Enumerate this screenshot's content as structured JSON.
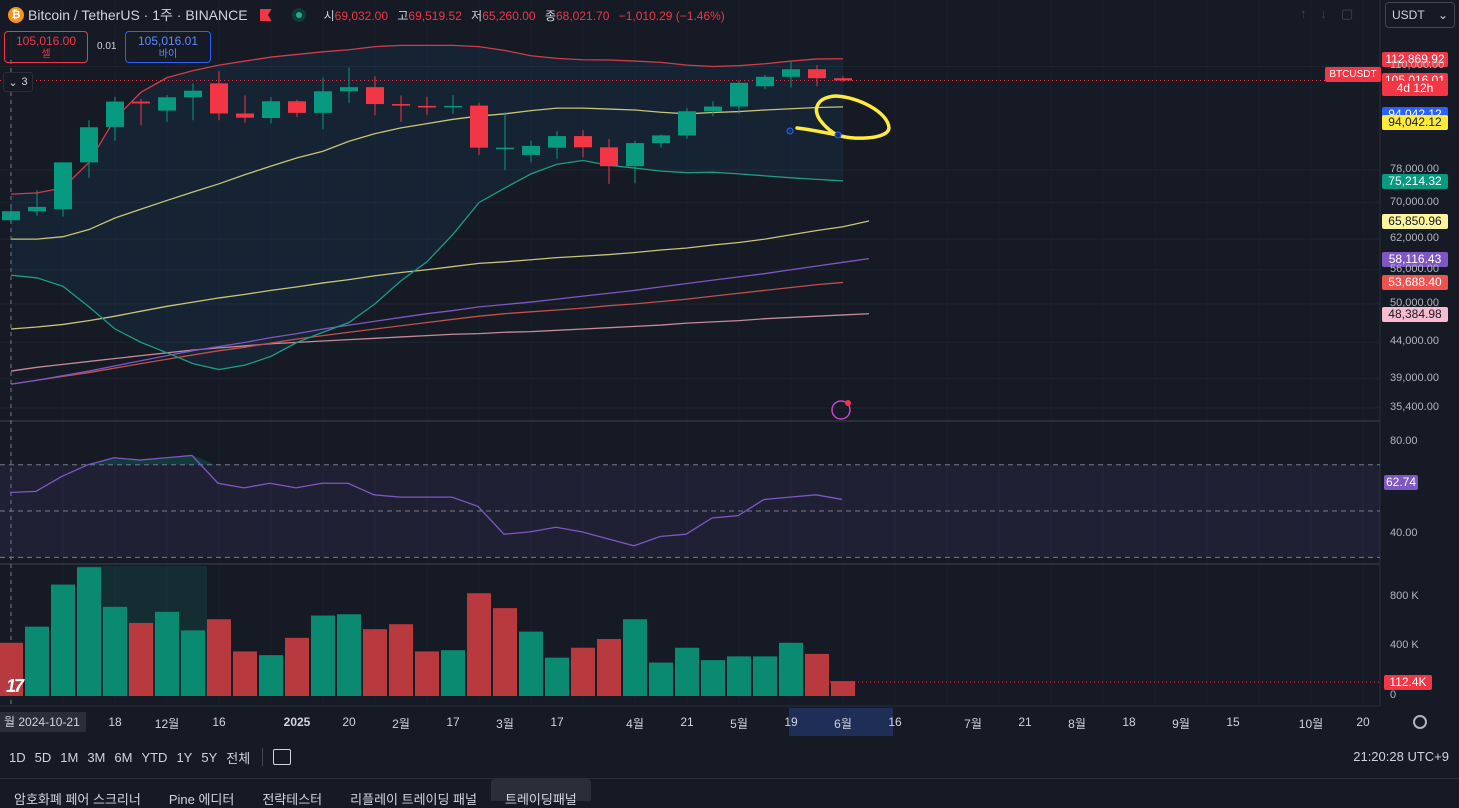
{
  "header": {
    "title": "Bitcoin / TetherUS · 1주 · BINANCE",
    "coin_glyph": "₿",
    "ohlc": [
      {
        "k": "시",
        "v": "69,032.00"
      },
      {
        "k": "고",
        "v": "69,519.52"
      },
      {
        "k": "저",
        "v": "65,260.00"
      },
      {
        "k": "종",
        "v": "68,021.70"
      }
    ],
    "change": "−1,010.29 (−1.46%)"
  },
  "trade": {
    "sell_price": "105,016.00",
    "sell_label": "셀",
    "spread": "0.01",
    "buy_price": "105,016.01",
    "buy_label": "바이"
  },
  "indicator_collapse": "3",
  "currency_select": "USDT",
  "symbol_tag": "BTCUSDT",
  "price_labels": [
    {
      "text": "112,869.92",
      "bg": "#f23645",
      "fg": "#ffffff",
      "price": 112869.92
    },
    {
      "text": "105,016.01",
      "bg": "#f23645",
      "fg": "#ffffff",
      "price": 105016.01
    },
    {
      "text": "4d 12h",
      "bg": "#f23645",
      "fg": "#ffffff",
      "price": 102400
    },
    {
      "text": "94,042.12",
      "bg": "#2962ff",
      "fg": "#ffffff",
      "price": 94042.12
    },
    {
      "text": "94,042.12",
      "bg": "#ffeb3b",
      "fg": "#131722",
      "price": 91500
    },
    {
      "text": "75,214.32",
      "bg": "#089981",
      "fg": "#ffffff",
      "price": 75214.32
    },
    {
      "text": "65,850.96",
      "bg": "#fff59d",
      "fg": "#131722",
      "price": 65850.96
    },
    {
      "text": "58,116.43",
      "bg": "#7e57c2",
      "fg": "#ffffff",
      "price": 58116.43
    },
    {
      "text": "53,688.40",
      "bg": "#ef5350",
      "fg": "#ffffff",
      "price": 53688.4
    },
    {
      "text": "48,384.98",
      "bg": "#f8bbd0",
      "fg": "#131722",
      "price": 48384.98
    }
  ],
  "price_ticks": [
    {
      "text": "110,000.00",
      "price": 110000
    },
    {
      "text": "78,000.00",
      "price": 78000
    },
    {
      "text": "70,000.00",
      "price": 70000
    },
    {
      "text": "62,000.00",
      "price": 62000
    },
    {
      "text": "56,000.00",
      "price": 56000
    },
    {
      "text": "50,000.00",
      "price": 50000
    },
    {
      "text": "44,000.00",
      "price": 44000
    },
    {
      "text": "39,000.00",
      "price": 39000
    },
    {
      "text": "35,400.00",
      "price": 35400
    }
  ],
  "rsi": {
    "ticks": [
      "80.00",
      "60.00",
      "40.00"
    ],
    "ticks_values": [
      80,
      60,
      40
    ],
    "current": "62.74",
    "current_value": 62.74,
    "values": [
      58,
      58.5,
      65,
      70,
      73,
      72,
      73,
      74,
      62,
      60,
      62,
      60,
      62,
      62,
      57,
      56,
      56,
      56,
      52,
      40,
      41,
      43,
      41,
      38,
      35,
      39,
      40,
      47,
      48,
      55,
      56,
      57,
      55,
      54
    ]
  },
  "volume": {
    "ticks": [
      "800 K",
      "400 K",
      "0"
    ],
    "ticks_values": [
      800,
      400,
      0
    ],
    "current": "112.4K",
    "current_value": 112.4,
    "values": [
      430,
      560,
      900,
      1040,
      720,
      590,
      680,
      530,
      620,
      360,
      330,
      470,
      650,
      660,
      540,
      580,
      360,
      370,
      830,
      710,
      520,
      310,
      390,
      460,
      620,
      270,
      390,
      290,
      320,
      320,
      430,
      340,
      120
    ],
    "up": [
      false,
      true,
      true,
      true,
      true,
      false,
      true,
      true,
      false,
      false,
      true,
      false,
      true,
      true,
      false,
      false,
      false,
      true,
      false,
      false,
      true,
      true,
      false,
      false,
      true,
      true,
      true,
      true,
      true,
      true,
      true,
      false,
      false
    ]
  },
  "chart_data": {
    "type": "candlestick",
    "scale": "log",
    "ylim": [
      34000,
      125000
    ],
    "candles": [
      {
        "o": 66000,
        "h": 69500,
        "l": 65260,
        "c": 68021
      },
      {
        "o": 68000,
        "h": 73000,
        "l": 67000,
        "c": 69000
      },
      {
        "o": 68500,
        "h": 80000,
        "l": 66800,
        "c": 80000
      },
      {
        "o": 80000,
        "h": 92000,
        "l": 76000,
        "c": 89900
      },
      {
        "o": 90000,
        "h": 99500,
        "l": 86000,
        "c": 97900
      },
      {
        "o": 97900,
        "h": 98800,
        "l": 90500,
        "c": 97300
      },
      {
        "o": 95000,
        "h": 100000,
        "l": 91500,
        "c": 99300
      },
      {
        "o": 99300,
        "h": 104000,
        "l": 92000,
        "c": 101500
      },
      {
        "o": 104000,
        "h": 108300,
        "l": 92000,
        "c": 94100
      },
      {
        "o": 94100,
        "h": 99900,
        "l": 91300,
        "c": 92800
      },
      {
        "o": 92700,
        "h": 99300,
        "l": 91000,
        "c": 98000
      },
      {
        "o": 98000,
        "h": 98500,
        "l": 93000,
        "c": 94300
      },
      {
        "o": 94300,
        "h": 106000,
        "l": 89300,
        "c": 101300
      },
      {
        "o": 101300,
        "h": 109600,
        "l": 97500,
        "c": 102700
      },
      {
        "o": 102700,
        "h": 106500,
        "l": 93500,
        "c": 97100
      },
      {
        "o": 97100,
        "h": 99900,
        "l": 91500,
        "c": 96600
      },
      {
        "o": 96500,
        "h": 99500,
        "l": 93700,
        "c": 96000
      },
      {
        "o": 96200,
        "h": 100000,
        "l": 94000,
        "c": 96500
      },
      {
        "o": 96600,
        "h": 97500,
        "l": 82000,
        "c": 84000
      },
      {
        "o": 84000,
        "h": 94500,
        "l": 78000,
        "c": 84000
      },
      {
        "o": 82000,
        "h": 86000,
        "l": 80000,
        "c": 84500
      },
      {
        "o": 84000,
        "h": 88700,
        "l": 81000,
        "c": 87300
      },
      {
        "o": 87300,
        "h": 89000,
        "l": 81300,
        "c": 84100
      },
      {
        "o": 84100,
        "h": 86500,
        "l": 74500,
        "c": 79000
      },
      {
        "o": 79000,
        "h": 86000,
        "l": 74600,
        "c": 85300
      },
      {
        "o": 85300,
        "h": 87800,
        "l": 84000,
        "c": 87500
      },
      {
        "o": 87500,
        "h": 95800,
        "l": 86500,
        "c": 94800
      },
      {
        "o": 94800,
        "h": 98000,
        "l": 93300,
        "c": 96300
      },
      {
        "o": 96300,
        "h": 105000,
        "l": 94000,
        "c": 104200
      },
      {
        "o": 103000,
        "h": 107000,
        "l": 102000,
        "c": 106300
      },
      {
        "o": 106300,
        "h": 111900,
        "l": 102600,
        "c": 109000
      },
      {
        "o": 109000,
        "h": 110500,
        "l": 103000,
        "c": 105800
      },
      {
        "o": 105800,
        "h": 106500,
        "l": 104500,
        "c": 105016
      }
    ],
    "bb_upper": [
      72000,
      72300,
      73500,
      80000,
      92500,
      101000,
      106000,
      108500,
      110500,
      112000,
      113500,
      114500,
      115500,
      116300,
      117500,
      118000,
      118000,
      118000,
      117500,
      116000,
      114000,
      113000,
      112500,
      112400,
      112000,
      111500,
      110500,
      110000,
      110300,
      111000,
      112000,
      112800,
      112870
    ],
    "bb_middle": [
      62000,
      62000,
      62500,
      64000,
      66500,
      68500,
      70500,
      72500,
      74500,
      76800,
      79000,
      81200,
      83000,
      85800,
      88000,
      89700,
      91000,
      92300,
      93300,
      94000,
      95000,
      95800,
      95800,
      95500,
      95200,
      94500,
      94000,
      94400,
      94700,
      95200,
      95600,
      96000,
      96200
    ],
    "bb_lower": [
      55000,
      54500,
      53000,
      49500,
      46000,
      44000,
      42500,
      41000,
      40200,
      40800,
      42000,
      44000,
      45500,
      47000,
      50000,
      54000,
      57500,
      63000,
      70000,
      73500,
      77000,
      79500,
      80500,
      79200,
      78500,
      77700,
      77300,
      77400,
      77000,
      76500,
      76000,
      75600,
      75214
    ],
    "ma_yellow": [
      46000,
      46300,
      46700,
      47300,
      48000,
      48800,
      49600,
      50300,
      51000,
      51600,
      52300,
      52900,
      53600,
      54200,
      54900,
      55500,
      56000,
      56600,
      57200,
      57500,
      57900,
      58300,
      58600,
      58900,
      59300,
      59800,
      60200,
      60800,
      61300,
      62000,
      62900,
      63800,
      64600,
      65851
    ],
    "ma_purple": [
      38300,
      38800,
      39400,
      40000,
      40700,
      41400,
      42100,
      42800,
      43400,
      44000,
      44700,
      45300,
      46000,
      46600,
      47200,
      47800,
      48400,
      48900,
      49500,
      49900,
      50300,
      50800,
      51300,
      51800,
      52300,
      52900,
      53500,
      54100,
      54700,
      55300,
      56000,
      56700,
      57400,
      58116
    ],
    "ma_red": [
      38300,
      38800,
      39300,
      39800,
      40400,
      41000,
      41600,
      42200,
      42800,
      43300,
      43900,
      44500,
      45000,
      45500,
      46000,
      46500,
      47000,
      47500,
      48000,
      48400,
      48700,
      49000,
      49300,
      49700,
      50000,
      50400,
      50800,
      51300,
      51800,
      52300,
      52800,
      53300,
      53688
    ],
    "ma_pink": [
      40000,
      40500,
      40900,
      41300,
      41700,
      42100,
      42500,
      42900,
      43200,
      43500,
      43800,
      44000,
      44200,
      44400,
      44600,
      44800,
      45000,
      45200,
      45300,
      45500,
      45600,
      45800,
      46000,
      46200,
      46400,
      46600,
      46900,
      47100,
      47300,
      47600,
      47800,
      48000,
      48200,
      48385
    ]
  },
  "x_axis": {
    "start_label": "월 2024-10-21",
    "labels": [
      {
        "t": "18",
        "i": 4
      },
      {
        "t": "12월",
        "i": 6
      },
      {
        "t": "16",
        "i": 8
      },
      {
        "t": "2025",
        "i": 11,
        "bold": true
      },
      {
        "t": "20",
        "i": 13
      },
      {
        "t": "2월",
        "i": 15
      },
      {
        "t": "17",
        "i": 17
      },
      {
        "t": "3월",
        "i": 19
      },
      {
        "t": "17",
        "i": 21
      },
      {
        "t": "4월",
        "i": 24
      },
      {
        "t": "21",
        "i": 26
      },
      {
        "t": "5월",
        "i": 28
      },
      {
        "t": "19",
        "i": 30
      },
      {
        "t": "6월",
        "i": 32
      },
      {
        "t": "16",
        "i": 34
      },
      {
        "t": "7월",
        "i": 37
      },
      {
        "t": "21",
        "i": 39
      },
      {
        "t": "8월",
        "i": 41
      },
      {
        "t": "18",
        "i": 43
      },
      {
        "t": "9월",
        "i": 45
      },
      {
        "t": "15",
        "i": 47
      },
      {
        "t": "10월",
        "i": 50
      },
      {
        "t": "20",
        "i": 52
      }
    ]
  },
  "timeframes": [
    "1D",
    "5D",
    "1M",
    "3M",
    "6M",
    "YTD",
    "1Y",
    "5Y",
    "전체"
  ],
  "clock": "21:20:28 UTC+9",
  "bottom_tabs": [
    {
      "label": "암호화폐 페어 스크리너",
      "active": false
    },
    {
      "label": "Pine 에디터",
      "active": false
    },
    {
      "label": "전략테스터",
      "active": false
    },
    {
      "label": "리플레이 트레이딩 패널",
      "active": false
    },
    {
      "label": "트레이딩패널",
      "active": true
    }
  ],
  "colors": {
    "up": "#089981",
    "down": "#f23645",
    "bg": "#161a25"
  }
}
